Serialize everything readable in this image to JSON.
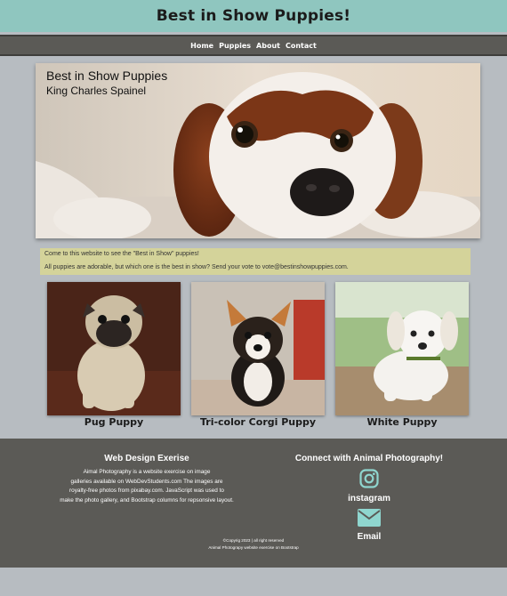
{
  "header": {
    "site_title": "Best in Show Puppies!"
  },
  "nav": {
    "items": [
      "Home",
      "Puppies",
      "About",
      "Contact"
    ]
  },
  "hero": {
    "title": "Best in Show Puppies",
    "subtitle": "King Charles Spainel"
  },
  "intro": {
    "line1": "Come to this website to see the \"Best in Show\" puppies!",
    "line2": "All puppies are adorable, but which one is the best in show? Send your vote to vote@bestinshowpuppies.com."
  },
  "gallery": [
    {
      "caption": "Pug Puppy"
    },
    {
      "caption": "Tri-color Corgi Puppy"
    },
    {
      "caption": "White Puppy"
    }
  ],
  "footer": {
    "left_heading": "Web Design Exerise",
    "left_lines": [
      "Aimal Photography is a website exercise on image",
      "galleries available on WebDevStudents.com The images are",
      "royalty-free photos from pixabay.com. JavaScript was used to",
      "make the photo gallery, and Bootstrap columns for repsonsive layout."
    ],
    "right_heading": "Connect with Animal Photography!",
    "social": [
      {
        "label": "instagram",
        "icon": "instagram-icon"
      },
      {
        "label": "Email",
        "icon": "envelope-icon"
      }
    ],
    "copyright": "©Copyrig 2023 | all right reserved",
    "credit": "Animal Photograpy website exercise on Bootstrap"
  },
  "colors": {
    "page_bg": "#b7bcc1",
    "header_bg": "#8fc6bf",
    "nav_bg": "#5b5a56",
    "intro_bg": "#d4d39a",
    "footer_bg": "#5b5a56"
  }
}
